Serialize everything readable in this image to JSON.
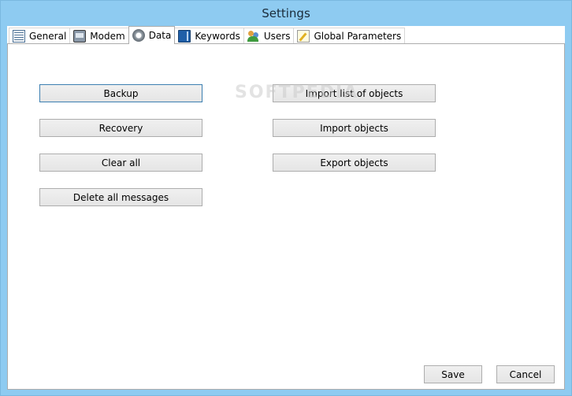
{
  "window": {
    "title": "Settings"
  },
  "tabs": [
    {
      "label": "General",
      "icon": "list-icon"
    },
    {
      "label": "Modem",
      "icon": "modem-icon"
    },
    {
      "label": "Data",
      "icon": "gear-disk-icon",
      "active": true
    },
    {
      "label": "Keywords",
      "icon": "book-icon"
    },
    {
      "label": "Users",
      "icon": "users-icon"
    },
    {
      "label": "Global Parameters",
      "icon": "pencil-note-icon"
    }
  ],
  "data_panel": {
    "backup_label": "Backup",
    "recovery_label": "Recovery",
    "clear_all_label": "Clear all",
    "delete_all_messages_label": "Delete all messages",
    "import_list_label": "Import list of objects",
    "import_objects_label": "Import objects",
    "export_objects_label": "Export objects"
  },
  "watermark": "SOFTPEDIA",
  "footer": {
    "save_label": "Save",
    "cancel_label": "Cancel"
  },
  "colors": {
    "frame": "#8ecbf1",
    "focus_border": "#3c7fb1"
  }
}
